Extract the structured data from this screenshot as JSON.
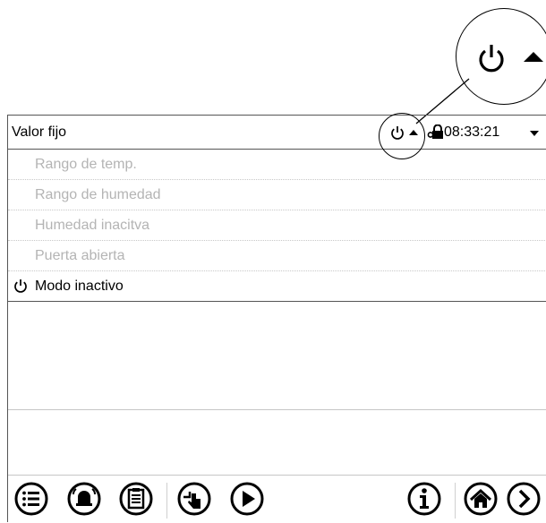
{
  "header": {
    "title": "Valor fijo",
    "time": "08:33:21",
    "icons": [
      "power-icon",
      "arrow-up-icon",
      "lock-icon",
      "dropdown-arrow-icon"
    ]
  },
  "callout": {
    "icons": [
      "power-icon",
      "arrow-up-icon"
    ]
  },
  "list": {
    "items": [
      {
        "label": "Rango de temp.",
        "state": "inactive"
      },
      {
        "label": "Rango de humedad",
        "state": "inactive"
      },
      {
        "label": "Humedad inacitva",
        "state": "inactive"
      },
      {
        "label": "Puerta abierta",
        "state": "inactive"
      },
      {
        "label": "Modo inactivo",
        "state": "active",
        "icon": "power-icon"
      }
    ]
  },
  "toolbar": {
    "buttons": [
      "menu-button",
      "alarm-button",
      "event-list-button",
      "manual-mode-button",
      "program-start-button",
      "info-button",
      "home-button",
      "next-button"
    ]
  }
}
